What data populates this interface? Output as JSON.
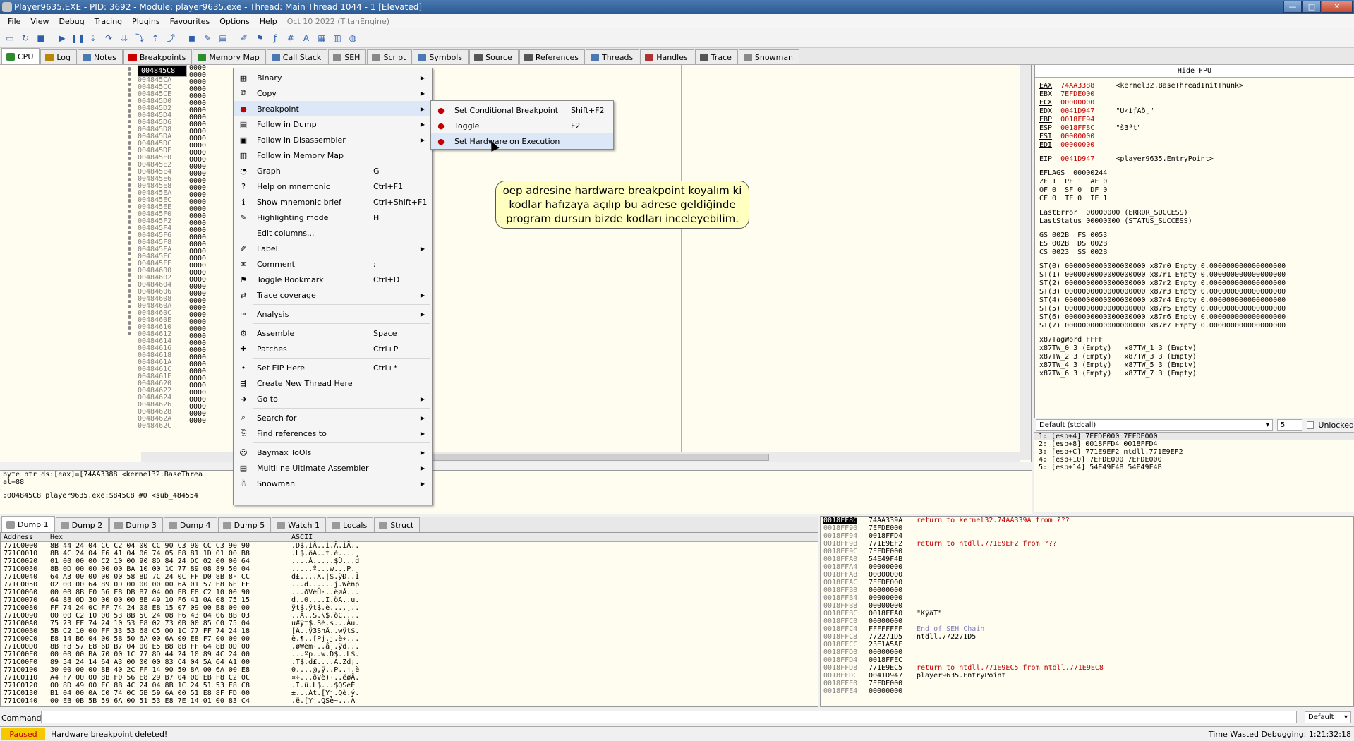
{
  "window": {
    "title": "Player9635.EXE - PID: 3692 - Module: player9635.exe - Thread: Main Thread 1044 - 1 [Elevated]"
  },
  "menu": [
    "File",
    "View",
    "Debug",
    "Tracing",
    "Plugins",
    "Favourites",
    "Options",
    "Help",
    "Oct 10 2022 (TitanEngine)"
  ],
  "toolbar_icons": [
    "open-icon",
    "restart-icon",
    "close-icon",
    "run-icon",
    "pause-icon",
    "step-into-icon",
    "step-over-icon",
    "trace-into-icon",
    "trace-over-icon",
    "execute-till-return-icon",
    "run-to-user-code-icon",
    "scylla-icon",
    "patch-icon",
    "comment-icon",
    "label-icon",
    "bookmark-icon",
    "function-icon",
    "hash-icon",
    "font-icon",
    "dump-icon",
    "calculator-icon",
    "help-icon"
  ],
  "tabs": [
    {
      "label": "CPU",
      "color": "#2e8b2e"
    },
    {
      "label": "Log",
      "color": "#b8860b"
    },
    {
      "label": "Notes",
      "color": "#4a78b0"
    },
    {
      "label": "Breakpoints",
      "color": "#cc0000"
    },
    {
      "label": "Memory Map",
      "color": "#2e8b2e"
    },
    {
      "label": "Call Stack",
      "color": "#4a78b0"
    },
    {
      "label": "SEH",
      "color": "#888888"
    },
    {
      "label": "Script",
      "color": "#888888"
    },
    {
      "label": "Symbols",
      "color": "#4a78b0"
    },
    {
      "label": "Source",
      "color": "#555555"
    },
    {
      "label": "References",
      "color": "#555555"
    },
    {
      "label": "Threads",
      "color": "#4a78b0"
    },
    {
      "label": "Handles",
      "color": "#aa3333"
    },
    {
      "label": "Trace",
      "color": "#555555"
    },
    {
      "label": "Snowman",
      "color": "#888888"
    }
  ],
  "disasm": {
    "addresses": [
      "004845C8",
      "004845CA",
      "004845CC",
      "004845CE",
      "004845D0",
      "004845D2",
      "004845D4",
      "004845D6",
      "004845D8",
      "004845DA",
      "004845DC",
      "004845DE",
      "004845E0",
      "004845E2",
      "004845E4",
      "004845E6",
      "004845E8",
      "004845EA",
      "004845EC",
      "004845EE",
      "004845F0",
      "004845F2",
      "004845F4",
      "004845F6",
      "004845F8",
      "004845FA",
      "004845FC",
      "004845FE",
      "00484600",
      "00484602",
      "00484604",
      "00484606",
      "00484608",
      "0048460A",
      "0048460C",
      "0048460E",
      "00484610",
      "00484612",
      "00484614",
      "00484616",
      "00484618",
      "0048461A",
      "0048461C",
      "0048461E",
      "00484620",
      "00484622",
      "00484624",
      "00484626",
      "00484628",
      "0048462A",
      "0048462C"
    ],
    "byte": "0000"
  },
  "info": {
    "line1": "byte ptr ds:[eax]=[74AA3388 <kernel32.BaseThrea",
    "line2": "al=88",
    "line3": ":004845C8 player9635.exe:$845C8 #0 <sub_484554"
  },
  "context_menu": [
    {
      "label": "Binary",
      "shortcut": "",
      "sub": true,
      "icon": "binary-icon"
    },
    {
      "label": "Copy",
      "shortcut": "",
      "sub": true,
      "icon": "copy-icon"
    },
    {
      "label": "Breakpoint",
      "shortcut": "",
      "sub": true,
      "icon": "breakpoint-icon",
      "hi": true
    },
    {
      "label": "Follow in Dump",
      "shortcut": "",
      "sub": true,
      "icon": "dump-icon"
    },
    {
      "label": "Follow in Disassembler",
      "shortcut": "",
      "sub": true,
      "icon": "cpu-icon"
    },
    {
      "label": "Follow in Memory Map",
      "shortcut": "",
      "sub": false,
      "icon": "memory-icon"
    },
    {
      "label": "Graph",
      "shortcut": "G",
      "sub": false,
      "icon": "graph-icon"
    },
    {
      "label": "Help on mnemonic",
      "shortcut": "Ctrl+F1",
      "sub": false,
      "icon": "help-icon"
    },
    {
      "label": "Show mnemonic brief",
      "shortcut": "Ctrl+Shift+F1",
      "sub": false,
      "icon": "info-icon"
    },
    {
      "label": "Highlighting mode",
      "shortcut": "H",
      "sub": false,
      "icon": "highlight-icon"
    },
    {
      "label": "Edit columns...",
      "shortcut": "",
      "sub": false,
      "icon": ""
    },
    {
      "label": "Label",
      "shortcut": "",
      "sub": true,
      "icon": "label-icon"
    },
    {
      "label": "Comment",
      "shortcut": ";",
      "sub": false,
      "icon": "comment-icon"
    },
    {
      "label": "Toggle Bookmark",
      "shortcut": "Ctrl+D",
      "sub": false,
      "icon": "bookmark-icon"
    },
    {
      "label": "Trace coverage",
      "shortcut": "",
      "sub": true,
      "icon": "trace-icon"
    },
    {
      "label": "Analysis",
      "shortcut": "",
      "sub": true,
      "icon": "analysis-icon",
      "gap": true
    },
    {
      "label": "Assemble",
      "shortcut": "Space",
      "sub": false,
      "icon": "assemble-icon",
      "gap": true
    },
    {
      "label": "Patches",
      "shortcut": "Ctrl+P",
      "sub": false,
      "icon": "patch-icon"
    },
    {
      "label": "Set EIP Here",
      "shortcut": "Ctrl+*",
      "sub": false,
      "icon": "eip-icon",
      "gap": true
    },
    {
      "label": "Create New Thread Here",
      "shortcut": "",
      "sub": false,
      "icon": "thread-icon"
    },
    {
      "label": "Go to",
      "shortcut": "",
      "sub": true,
      "icon": "goto-icon"
    },
    {
      "label": "Search for",
      "shortcut": "",
      "sub": true,
      "icon": "search-icon",
      "gap": true
    },
    {
      "label": "Find references to",
      "shortcut": "",
      "sub": true,
      "icon": "references-icon"
    },
    {
      "label": "Baymax ToOls",
      "shortcut": "",
      "sub": true,
      "icon": "baymax-icon",
      "gap": true
    },
    {
      "label": "Multiline Ultimate Assembler",
      "shortcut": "",
      "sub": true,
      "icon": "assembler-icon"
    },
    {
      "label": "Snowman",
      "shortcut": "",
      "sub": true,
      "icon": "snowman-icon"
    }
  ],
  "submenu": [
    {
      "label": "Set Conditional Breakpoint",
      "shortcut": "Shift+F2",
      "icon": "conditional-breakpoint-icon"
    },
    {
      "label": "Toggle",
      "shortcut": "F2",
      "icon": "toggle-breakpoint-icon"
    },
    {
      "label": "Set Hardware on Execution",
      "shortcut": "",
      "icon": "hardware-breakpoint-icon",
      "hi": true
    }
  ],
  "callout": "oep adresine hardware breakpoint koyalım ki kodlar hafızaya açılıp bu adrese geldiğinde program dursun bizde kodları inceleyebilim.",
  "registers": {
    "hide_fpu": "Hide FPU",
    "lines": [
      [
        "EAX",
        "74AA3388",
        "<kernel32.BaseThreadInitThunk>"
      ],
      [
        "EBX",
        "7EFDE000",
        ""
      ],
      [
        "ECX",
        "00000000",
        ""
      ],
      [
        "EDX",
        "0041D947",
        "\"U‹ìƒÄð¸\""
      ],
      [
        "EBP",
        "0018FF94",
        ""
      ],
      [
        "ESP",
        "0018FF8C",
        "\"š3ªt\""
      ],
      [
        "ESI",
        "00000000",
        ""
      ],
      [
        "EDI",
        "00000000",
        ""
      ]
    ],
    "eip": [
      "EIP",
      "0041D947",
      "<player9635.EntryPoint>"
    ],
    "eflags": "EFLAGS  00000244",
    "flags1": "ZF 1  PF 1  AF 0",
    "flags2": "OF 0  SF 0  DF 0",
    "flags3": "CF 0  TF 0  IF 1",
    "lasterror": "LastError  00000000 (ERROR_SUCCESS)",
    "laststatus": "LastStatus 00000000 (STATUS_SUCCESS)",
    "seg1": "GS 002B  FS 0053",
    "seg2": "ES 002B  DS 002B",
    "seg3": "CS 0023  SS 002B",
    "st": [
      "ST(0) 0000000000000000000 x87r0 Empty 0.000000000000000000",
      "ST(1) 0000000000000000000 x87r1 Empty 0.000000000000000000",
      "ST(2) 0000000000000000000 x87r2 Empty 0.000000000000000000",
      "ST(3) 0000000000000000000 x87r3 Empty 0.000000000000000000",
      "ST(4) 0000000000000000000 x87r4 Empty 0.000000000000000000",
      "ST(5) 0000000000000000000 x87r5 Empty 0.000000000000000000",
      "ST(6) 0000000000000000000 x87r6 Empty 0.000000000000000000",
      "ST(7) 0000000000000000000 x87r7 Empty 0.000000000000000000"
    ],
    "tagword": "x87TagWord FFFF",
    "tw": [
      "x87TW_0 3 (Empty)   x87TW_1 3 (Empty)",
      "x87TW_2 3 (Empty)   x87TW_3 3 (Empty)",
      "x87TW_4 3 (Empty)   x87TW_5 3 (Empty)",
      "x87TW_6 3 (Empty)   x87TW_7 3 (Empty)"
    ]
  },
  "callconv": {
    "value": "Default (stdcall)",
    "count": "5",
    "unlocked": "Unlocked"
  },
  "args": [
    "1: [esp+4] 7EFDE000 7EFDE000",
    "2: [esp+8] 0018FFD4 0018FFD4",
    "3: [esp+C] 771E9EF2 ntdll.771E9EF2",
    "4: [esp+10] 7EFDE000 7EFDE000",
    "5: [esp+14] 54E49F4B 54E49F4B"
  ],
  "dump_tabs": [
    {
      "label": "Dump 1",
      "active": true
    },
    {
      "label": "Dump 2"
    },
    {
      "label": "Dump 3"
    },
    {
      "label": "Dump 4"
    },
    {
      "label": "Dump 5"
    },
    {
      "label": "Watch 1"
    },
    {
      "label": "Locals"
    },
    {
      "label": "Struct"
    }
  ],
  "dump": {
    "headers": {
      "address": "Address",
      "hex": "Hex",
      "ascii": "ASCII"
    },
    "rows": [
      [
        "771C0000",
        "8B 44 24 04 CC C2 04 00 CC 90 C3 90 CC C3 90 90",
        ".D$.ÌÂ..Ì.Ã.ÌÃ.."
      ],
      [
        "771C0010",
        "8B 4C 24 04 F6 41 04 06 74 05 E8 81 1D 01 00 B8",
        ".L$.öA..t.è....¸"
      ],
      [
        "771C0020",
        "01 00 00 00 C2 10 00 90 8D 84 24 DC 02 00 00 64",
        "....Â.....$Ü...d"
      ],
      [
        "771C0030",
        "8B 0D 00 00 00 00 BA 10 00 1C 77 89 08 89 50 04",
        ".....º...w...P."
      ],
      [
        "771C0040",
        "64 A3 00 00 00 00 58 8D 7C 24 0C FF D0 8B 8F CC",
        "d£....X.|$.ÿÐ..Ì"
      ],
      [
        "771C0050",
        "02 00 00 64 89 0D 00 00 00 00 6A 01 57 E8 6E FE",
        "...d......j.Wènþ"
      ],
      [
        "771C0060",
        "00 00 8B F0 56 E8 DB B7 04 00 EB F8 C2 10 00 90",
        "...ðVèÛ·..ëøÂ..."
      ],
      [
        "771C0070",
        "64 8B 0D 30 00 00 00 8B 49 10 F6 41 0A 08 75 15",
        "d..0....I.öA..u."
      ],
      [
        "771C0080",
        "FF 74 24 0C FF 74 24 08 E8 15 07 09 00 B8 00 00",
        "ÿt$.ÿt$.è....¸.."
      ],
      [
        "771C0090",
        "00 00 C2 10 00 53 8B 5C 24 08 F6 43 04 06 8B 03",
        "..Â..S.\\$.öC...."
      ],
      [
        "771C00A0",
        "75 23 FF 74 24 10 53 E8 02 73 0B 00 85 C0 75 04",
        "u#ÿt$.Sè.s...Àu."
      ],
      [
        "771C00B0",
        "5B C2 10 00 FF 33 53 68 C5 00 1C 77 FF 74 24 18",
        "[Â..ÿ3ShÅ..wÿt$."
      ],
      [
        "771C00C0",
        "E8 14 B6 04 00 5B 50 6A 00 6A 00 E8 F7 00 00 00",
        "è.¶..[Pj.j.è÷..."
      ],
      [
        "771C00D0",
        "8B F8 57 E8 6D B7 04 00 E5 B8 8B FF 64 8B 0D 00",
        ".øWèm·..å¸.ÿd..."
      ],
      [
        "771C00E0",
        "00 00 00 BA 70 00 1C 77 8D 44 24 10 89 4C 24 00",
        "...ºp..w.D$..L$."
      ],
      [
        "771C00F0",
        "89 54 24 14 64 A3 00 00 00 83 C4 04 5A 64 A1 00",
        ".T$.d£....Ä.Zd¡."
      ],
      [
        "771C0100",
        "30 00 00 00 8B 40 2C FF 14 90 50 8A 00 6A 00 E8",
        "0....@,ÿ..P..j.è"
      ],
      [
        "771C0110",
        "A4 F7 00 00 8B F0 56 E8 29 B7 04 00 EB F8 C2 0C",
        "¤÷...ðVè)·..ëøÂ."
      ],
      [
        "771C0120",
        "00 8D 49 00 FC 8B 4C 24 04 8B 1C 24 51 53 E8 C8",
        ".I.ü.L$...$QSèÈ"
      ],
      [
        "771C0130",
        "B1 04 00 0A C0 74 0C 5B 59 6A 00 51 E8 8F FD 00",
        "±...Àt.[Yj.Qè.ý."
      ],
      [
        "771C0140",
        "00 EB 0B 5B 59 6A 00 51 53 E8 7E 14 01 00 83 C4",
        ".ë.[Yj.QSè~...Ä"
      ]
    ]
  },
  "stack": {
    "rows": [
      [
        "0018FF8C",
        "74AA339A",
        "return to kernel32.74AA339A from ???"
      ],
      [
        "0018FF90",
        "7EFDE000",
        ""
      ],
      [
        "0018FF94",
        "0018FFD4",
        ""
      ],
      [
        "0018FF98",
        "771E9EF2",
        "return to ntdll.771E9EF2 from ???"
      ],
      [
        "0018FF9C",
        "7EFDE000",
        ""
      ],
      [
        "0018FFA0",
        "54E49F4B",
        ""
      ],
      [
        "0018FFA4",
        "00000000",
        ""
      ],
      [
        "0018FFA8",
        "00000000",
        ""
      ],
      [
        "0018FFAC",
        "7EFDE000",
        ""
      ],
      [
        "0018FFB0",
        "00000000",
        ""
      ],
      [
        "0018FFB4",
        "00000000",
        ""
      ],
      [
        "0018FFB8",
        "00000000",
        ""
      ],
      [
        "0018FFBC",
        "0018FFA0",
        "\"KÿäT\""
      ],
      [
        "0018FFC0",
        "00000000",
        ""
      ],
      [
        "0018FFC4",
        "FFFFFFFF",
        "End of SEH Chain"
      ],
      [
        "0018FFC8",
        "772271D5",
        "ntdll.772271D5"
      ],
      [
        "0018FFCC",
        "23E1A5AF",
        ""
      ],
      [
        "0018FFD0",
        "00000000",
        ""
      ],
      [
        "0018FFD4",
        "0018FFEC",
        ""
      ],
      [
        "0018FFD8",
        "771E9EC5",
        "return to ntdll.771E9EC5 from ntdll.771E9EC8"
      ],
      [
        "0018FFDC",
        "0041D947",
        "player9635.EntryPoint"
      ],
      [
        "0018FFE0",
        "7EFDE000",
        ""
      ],
      [
        "0018FFE4",
        "00000000",
        ""
      ]
    ]
  },
  "command": {
    "label": "Command:",
    "mode": "Default"
  },
  "status": {
    "state": "Paused",
    "message": "Hardware breakpoint deleted!",
    "time": "Time Wasted Debugging: 1:21:32:18"
  }
}
